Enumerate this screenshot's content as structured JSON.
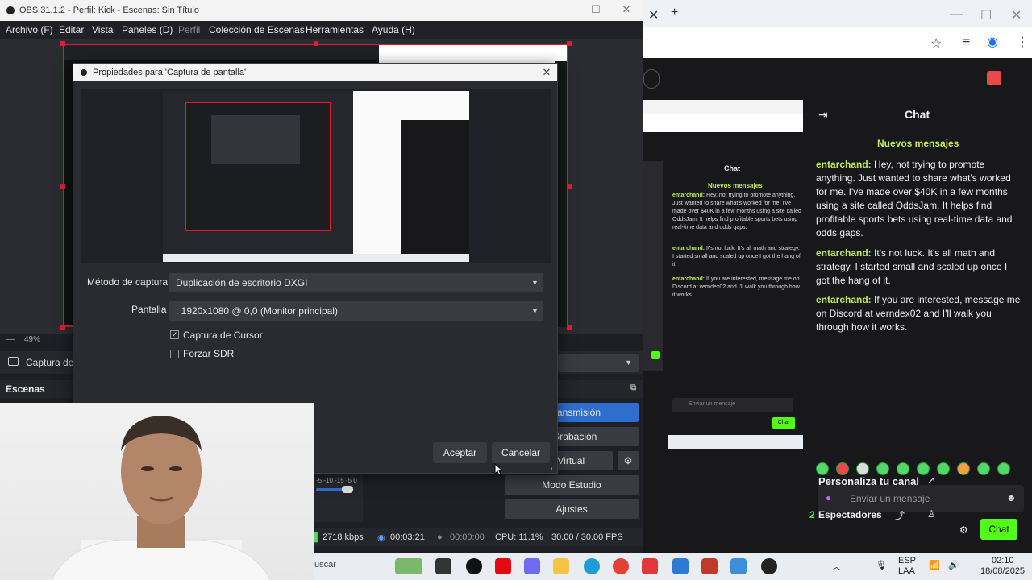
{
  "obs": {
    "title": "OBS 31.1.2 - Perfil: Kick - Escenas: Sin Título",
    "menu": [
      "Archivo (F)",
      "Editar",
      "Vista",
      "Paneles (D)",
      "Perfil",
      "Colección de Escenas",
      "Herramientas",
      "Ayuda (H)"
    ],
    "zoom": "49%",
    "source_label": "Captura de",
    "scenes_label": "Escenas",
    "controls": {
      "stream": "r Transmisión",
      "record": "r Grabación",
      "virtual_cam": "mara Virtual",
      "studio": "Modo Estudio",
      "settings": "Ajustes"
    },
    "status": {
      "kbps": "2718 kbps",
      "stream_time": "00:03:21",
      "rec_time": "00:00:00",
      "cpu": "CPU: 11.1%",
      "fps": "30.00 / 30.00 FPS"
    },
    "mixer_db": "-5 -10 -15 -5 0"
  },
  "dialog": {
    "title": "Propiedades para 'Captura de pantalla'",
    "method_label": "Método de captura",
    "method_value": "Duplicación de escritorio DXGI",
    "screen_label": "Pantalla",
    "screen_value": ": 1920x1080 @ 0,0 (Monitor principal)",
    "cursor_label": "Captura de Cursor",
    "cursor_checked": true,
    "sdr_label": "Forzar SDR",
    "sdr_checked": false,
    "accept": "Aceptar",
    "cancel": "Cancelar"
  },
  "taskbar": {
    "search": "uscar",
    "lang_top": "ESP",
    "lang_bottom": "LAA",
    "time": "02:10",
    "date": "18/08/2025"
  },
  "chat": {
    "title": "Chat",
    "new_messages": "Nuevos mensajes",
    "messages": [
      {
        "user": "entarchand:",
        "text": "Hey, not trying to promote anything. Just wanted to share what's worked for me. I've made over $40K in a few months using a site called OddsJam. It helps find profitable sports bets using real-time data and odds gaps."
      },
      {
        "user": "entarchand:",
        "text": "It's not luck. It's all math and strategy. I started small and scaled up once I got the hang of it."
      },
      {
        "user": "entarchand:",
        "text": "If you are interested, message me on Discord at verndex02 and I'll walk you through how it works."
      }
    ],
    "customize": "Personaliza tu canal",
    "input_placeholder": "Enviar un mensaje",
    "viewers_count": "2",
    "viewers_label": "Espectadores",
    "chat_button": "Chat"
  },
  "colors": {
    "obs_red": "#e01c34",
    "kick_green": "#53fc18",
    "stream_blue": "#2d6ecf",
    "username_green": "#bfe75c"
  }
}
